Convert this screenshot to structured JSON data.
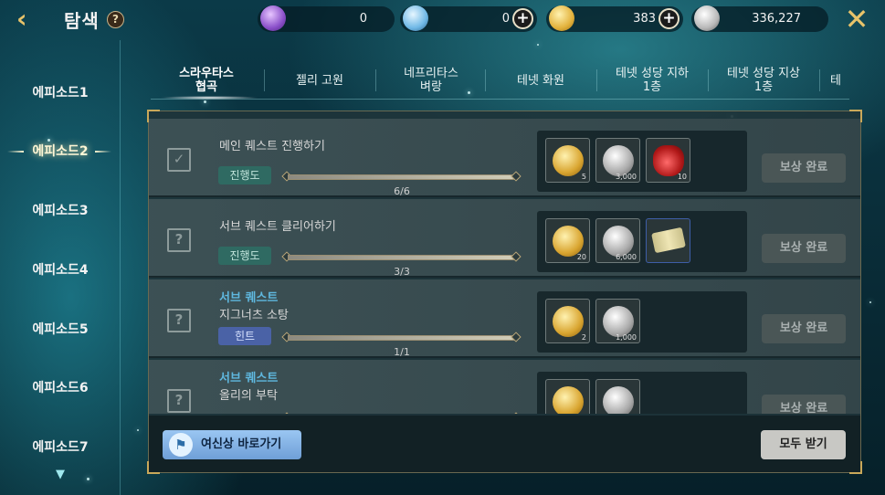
{
  "header": {
    "title": "탐색",
    "help_label": "?",
    "back_icon": "chevron-left-icon",
    "close_icon": "close-icon",
    "currencies": [
      {
        "name": "purple-gem-icon",
        "value": "0",
        "color": "#8a4fc9"
      },
      {
        "name": "blue-crystal-icon",
        "value": "0",
        "color": "#6fb8e6",
        "has_plus": true
      },
      {
        "name": "gold-coin-icon",
        "value": "383",
        "color": "#e3b23c",
        "has_plus": true
      },
      {
        "name": "silver-coin-icon",
        "value": "336,227",
        "color": "#b8b8b8"
      }
    ]
  },
  "sidebar": {
    "items": [
      {
        "label": "에피소드1",
        "active": false
      },
      {
        "label": "에피소드2",
        "active": true
      },
      {
        "label": "에피소드3",
        "active": false
      },
      {
        "label": "에피소드4",
        "active": false
      },
      {
        "label": "에피소드5",
        "active": false
      },
      {
        "label": "에피소드6",
        "active": false
      },
      {
        "label": "에피소드7",
        "active": false
      }
    ]
  },
  "tabs": [
    {
      "label": "스라우타스\n협곡",
      "active": true
    },
    {
      "label": "젤리 고원",
      "active": false
    },
    {
      "label": "네프리타스\n벼랑",
      "active": false
    },
    {
      "label": "테넷 화원",
      "active": false
    },
    {
      "label": "테넷 성당 지하\n1층",
      "active": false
    },
    {
      "label": "테넷 성당 지상\n1층",
      "active": false
    },
    {
      "label": "테",
      "active": false
    }
  ],
  "quests": [
    {
      "category": "",
      "title": "메인 퀘스트 진행하기",
      "icon": "scroll-check-icon",
      "badge": "진행도",
      "badge_type": "progress",
      "progress_text": "6/6",
      "progress": 1.0,
      "rewards": [
        {
          "icon": "gold-coin-icon",
          "count": "5"
        },
        {
          "icon": "silver-coin-icon",
          "count": "3,000"
        },
        {
          "icon": "red-potion-icon",
          "count": "10"
        }
      ],
      "claim_label": "보상 완료"
    },
    {
      "category": "",
      "title": "서브 퀘스트 클리어하기",
      "icon": "scroll-question-icon",
      "badge": "진행도",
      "badge_type": "progress",
      "progress_text": "3/3",
      "progress": 1.0,
      "rewards": [
        {
          "icon": "gold-coin-icon",
          "count": "20"
        },
        {
          "icon": "silver-coin-icon",
          "count": "6,000"
        },
        {
          "icon": "scroll-ticket-icon",
          "count": ""
        }
      ],
      "claim_label": "보상 완료"
    },
    {
      "category": "서브 퀘스트",
      "title": "지그너츠 소탕",
      "icon": "scroll-question-icon",
      "badge": "힌트",
      "badge_type": "hint",
      "progress_text": "1/1",
      "progress": 1.0,
      "rewards": [
        {
          "icon": "gold-coin-icon",
          "count": "2"
        },
        {
          "icon": "silver-coin-icon",
          "count": "1,000"
        }
      ],
      "claim_label": "보상 완료"
    },
    {
      "category": "서브 퀘스트",
      "title": "올리의 부탁",
      "icon": "scroll-question-icon",
      "badge": "",
      "badge_type": "progress",
      "progress_text": "",
      "progress": 1.0,
      "rewards": [
        {
          "icon": "gold-coin-icon",
          "count": ""
        },
        {
          "icon": "silver-coin-icon",
          "count": ""
        }
      ],
      "claim_label": "보상 완료"
    }
  ],
  "footer": {
    "goddess_label": "여신상 바로가기",
    "goddess_icon": "goddess-statue-icon",
    "claim_all_label": "모두 받기"
  }
}
